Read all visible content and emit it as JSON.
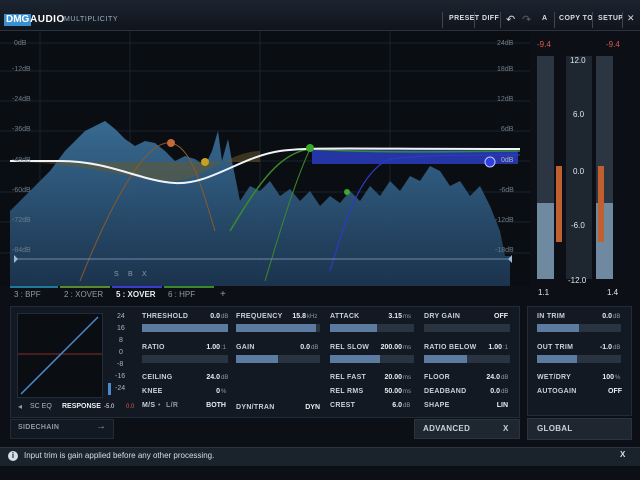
{
  "titlebar": {
    "logo": "DMG",
    "brand": "AUDIO",
    "product": "MULTIPLICITY",
    "preset": "PRESET",
    "diff": "DIFF",
    "ab": "A",
    "copy_to": "COPY TO",
    "setup": "SETUP"
  },
  "graph": {
    "left_db_labels": [
      "0dB",
      "-12dB",
      "-24dB",
      "-36dB",
      "-48dB",
      "-60dB",
      "-72dB",
      "-84dB"
    ],
    "right_db_labels": [
      "24dB",
      "18dB",
      "12dB",
      "6dB",
      "0dB",
      "-6dB",
      "-12dB",
      "-18dB"
    ],
    "mini_buttons": [
      "S",
      "B",
      "X"
    ]
  },
  "meters": {
    "left_peak": "-9.4",
    "right_peak": "-9.4",
    "scale": [
      "12.0",
      "6.0",
      "0.0",
      "-6.0",
      "-12.0"
    ],
    "left_value": "1.1",
    "right_value": "1.4",
    "left_level": 0.34,
    "right_level": 0.34,
    "left_gr": 0.3,
    "right_gr": 0.3
  },
  "tabs": [
    {
      "label": "3 : BPF",
      "color": "#1f7a9a"
    },
    {
      "label": "2 : XOVER",
      "color": "#5a8a2a"
    },
    {
      "label": "5 : XOVER",
      "color": "#3a3ad0"
    },
    {
      "label": "6 : HPF",
      "color": "#3a8a2a"
    }
  ],
  "add_tab": "+",
  "response": {
    "scale": [
      "24",
      "16",
      "8",
      "0",
      "-8",
      "-16",
      "-24"
    ],
    "sc_eq": "SC EQ",
    "response": "RESPONSE",
    "value_left": "-5.0",
    "value_right": "0.0"
  },
  "params": {
    "threshold": {
      "label": "THRESHOLD",
      "value": "0.0",
      "unit": "dB",
      "level": 1.0
    },
    "ratio": {
      "label": "RATIO",
      "value": "1.00",
      "unit": ":1",
      "level": 0.0
    },
    "ceiling": {
      "label": "CEILING",
      "value": "24.0",
      "unit": "dB"
    },
    "knee": {
      "label": "KNEE",
      "value": "0",
      "unit": "%"
    },
    "ms": {
      "label": "M/S",
      "label2": "L/R",
      "value": "BOTH"
    },
    "frequency": {
      "label": "FREQUENCY",
      "value": "15.8",
      "unit": "kHz",
      "level": 0.95
    },
    "gain": {
      "label": "GAIN",
      "value": "0.0",
      "unit": "dB",
      "level": 0.5
    },
    "dyntran": {
      "label": "DYN/TRAN",
      "value": "DYN"
    },
    "attack": {
      "label": "ATTACK",
      "value": "3.15",
      "unit": "ms",
      "level": 0.56
    },
    "rel_slow": {
      "label": "REL SLOW",
      "value": "200.00",
      "unit": "ms",
      "level": 0.6
    },
    "rel_fast": {
      "label": "REL FAST",
      "value": "20.00",
      "unit": "ms"
    },
    "rel_rms": {
      "label": "REL RMS",
      "value": "50.00",
      "unit": "ms"
    },
    "crest": {
      "label": "CREST",
      "value": "6.0",
      "unit": "dB"
    },
    "dry_gain": {
      "label": "DRY GAIN",
      "value": "OFF",
      "level": 0.0
    },
    "ratio_below": {
      "label": "RATIO BELOW",
      "value": "1.00",
      "unit": ":1",
      "level": 0.5
    },
    "floor": {
      "label": "FLOOR",
      "value": "24.0",
      "unit": "dB"
    },
    "deadband": {
      "label": "DEADBAND",
      "value": "0.0",
      "unit": "dB"
    },
    "shape": {
      "label": "SHAPE",
      "value": "LIN"
    }
  },
  "global": {
    "in_trim": {
      "label": "IN TRIM",
      "value": "0.0",
      "unit": "dB",
      "level": 0.5
    },
    "out_trim": {
      "label": "OUT TRIM",
      "value": "-1.0",
      "unit": "dB",
      "level": 0.48
    },
    "wet_dry": {
      "label": "WET/DRY",
      "value": "100",
      "unit": "%"
    },
    "autogain": {
      "label": "AUTOGAIN",
      "value": "OFF"
    },
    "title": "GLOBAL"
  },
  "sidechain": "SIDECHAIN",
  "advanced": "ADVANCED",
  "advanced_close": "X",
  "status": {
    "info": "i",
    "text": "Input trim is gain applied before any other processing.",
    "close": "X"
  }
}
